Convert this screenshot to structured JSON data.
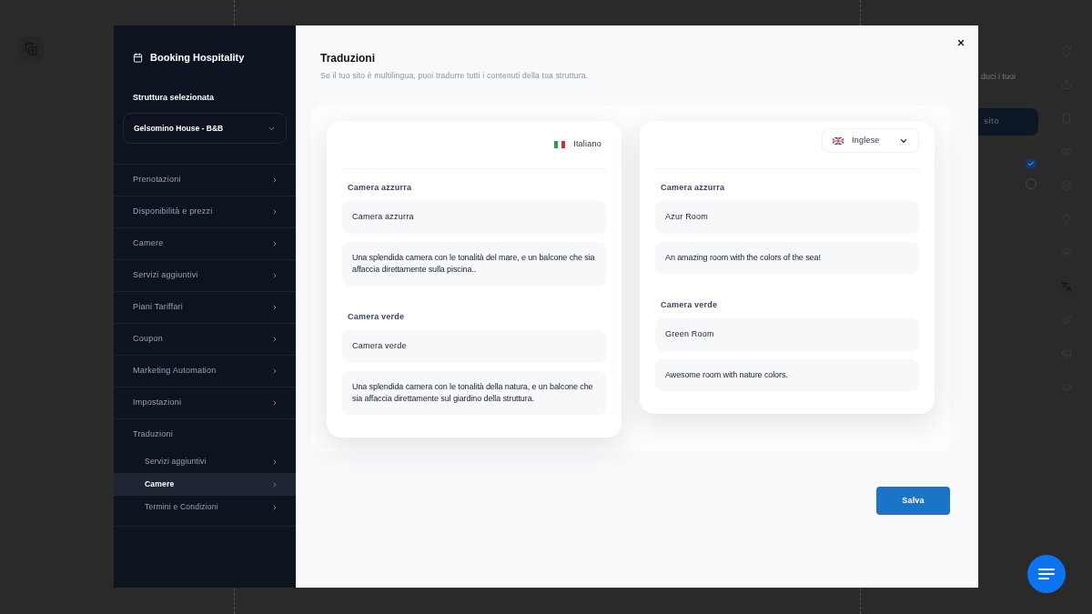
{
  "app_title": "Booking Hospitality",
  "property_label": "Struttura selezionata",
  "property_select": {
    "value": "Gelsomino House - B&B"
  },
  "menu": [
    {
      "label": "Prenotazioni"
    },
    {
      "label": "Disponibilità e prezzi"
    },
    {
      "label": "Camere"
    },
    {
      "label": "Servizi aggiuntivi"
    },
    {
      "label": "Piani Tariffari"
    },
    {
      "label": "Coupon"
    },
    {
      "label": "Marketing Automation"
    },
    {
      "label": "Impostazioni"
    },
    {
      "label": "Traduzioni",
      "children": [
        {
          "label": "Servizi aggiuntivi",
          "selected": false
        },
        {
          "label": "Camere",
          "selected": true
        },
        {
          "label": "Termini e Condizioni",
          "selected": false
        }
      ]
    }
  ],
  "page": {
    "title": "Traduzioni",
    "subtitle": "Se il tuo sito è multilingua, puoi tradurre tutti i contenuti della tua struttura."
  },
  "source": {
    "language": "Italiano",
    "kind": "it",
    "rooms": [
      {
        "label": "Camera azzurra",
        "name": "Camera azzurra",
        "description": "Una splendida camera con le tonalità del mare, e un balcone che sia affaccia direttamente sulla piscina.."
      },
      {
        "label": "Camera verde",
        "name": "Camera verde",
        "description": "Una splendida camera con le tonalità della natura, e un balcone che sia affaccia direttamente sul giardino della struttura."
      }
    ]
  },
  "target": {
    "language": "Inglese",
    "kind": "gb",
    "rooms": [
      {
        "label": "Camera azzurra",
        "name": "Azur Room",
        "description": "An amazing room with the colors of the sea!"
      },
      {
        "label": "Camera verde",
        "name": "Green Room",
        "description": "Awesome room with nature colors."
      }
    ]
  },
  "save_button": "Salva",
  "background": {
    "text": "duci i tuoi",
    "button": "sito",
    "options": [
      {
        "checked": true
      },
      {
        "checked": false
      }
    ]
  }
}
